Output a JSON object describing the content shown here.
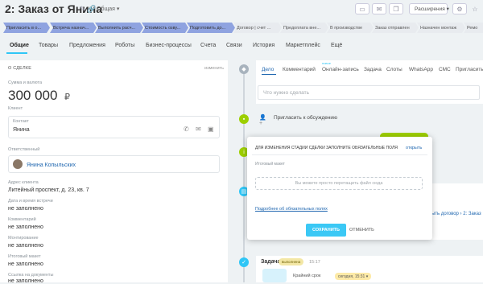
{
  "header": {
    "title": "2: Заказ от Янина",
    "category": "Общая",
    "extensions_label": "Расширения"
  },
  "stages": [
    {
      "label": "Пригласить в о...",
      "done": true
    },
    {
      "label": "Встреча назнач...",
      "done": true
    },
    {
      "label": "Выполнить расч...",
      "done": true
    },
    {
      "label": "Стоимость озву...",
      "done": true
    },
    {
      "label": "Подготовить до...",
      "done": true
    },
    {
      "label": "Договор | счет ...",
      "done": false
    },
    {
      "label": "Предоплата вне...",
      "done": false
    },
    {
      "label": "В производстве",
      "done": false
    },
    {
      "label": "Заказ отправлен",
      "done": false
    },
    {
      "label": "Назначен монтаж",
      "done": false
    },
    {
      "label": "Ремо",
      "done": false
    }
  ],
  "tabs": [
    "Общие",
    "Товары",
    "Предложения",
    "Роботы",
    "Бизнес-процессы",
    "Счета",
    "Связи",
    "История",
    "Маркетплейс",
    "Ещё"
  ],
  "deal": {
    "section_title": "О сделке",
    "edit_label": "изменить",
    "amount_label": "Сумма и валюта",
    "amount_value": "300 000",
    "currency": "₽",
    "client_label": "Клиент",
    "contact_label": "Контакт",
    "contact_name": "Янина",
    "responsible_label": "Ответственный",
    "responsible_name": "Янина Копыльских",
    "address_label": "Адрес клиента",
    "address_value": "Литейный проспект, д. 23, кв. 7",
    "meeting_label": "Дата и время встречи",
    "meeting_value": "не заполнено",
    "comment_label": "Комментарий",
    "comment_value": "не заполнено",
    "mounting_label": "Монтирование",
    "mounting_value": "не заполнено",
    "final_label": "Итоговый макет",
    "final_value": "не заполнено",
    "docs_label": "Ссылка на документы",
    "docs_value": "не заполнено"
  },
  "editor": {
    "tabs": [
      "Дело",
      "Комментарий",
      "Онлайн-запись",
      "Задача",
      "Слоты",
      "WhatsApp",
      "СМС",
      "Пригласить"
    ],
    "new_badge": "новое",
    "placeholder": "Что нужно сделать",
    "invite_text": "Пригласить к обсуждению"
  },
  "modal": {
    "header": "Для изменения стадии сделки заполните обязательные поля",
    "open_link": "открыть",
    "field_label": "Итоговый макет",
    "drop_text": "Вы можете просто перетащить файл сюда",
    "more_link": "Подробнее об обязательных полях",
    "save_label": "СОХРАНИТЬ",
    "cancel_label": "отменить"
  },
  "timeline": {
    "bg_link": "ыть договор › 2: Заказ",
    "task_label": "Задача",
    "task_badge": "выполнена",
    "task_time": "15:17",
    "deadline_label": "Крайний срок",
    "deadline_value": "сегодня, 15:31"
  }
}
